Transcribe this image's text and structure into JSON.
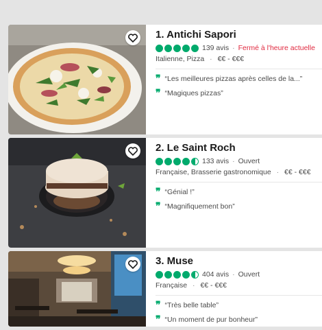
{
  "colors": {
    "accent": "#00aa6c",
    "closed": "#e0293f",
    "background": "#e4e4e4"
  },
  "restaurants": [
    {
      "title": "1. Antichi Sapori",
      "rating": 5.0,
      "reviews": "139 avis",
      "status": "Fermé à l'heure actuelle",
      "status_type": "closed",
      "cuisine": "Italienne, Pizza",
      "price": "€€ - €€€",
      "quotes": [
        "“Les meilleures pizzas après celles de la...”",
        "“Magiques pizzas”"
      ],
      "photo": "pizza-photo",
      "favorite_icon": "heart-icon"
    },
    {
      "title": "2. Le Saint Roch",
      "rating": 4.5,
      "reviews": "133 avis",
      "status": "Ouvert",
      "status_type": "open",
      "cuisine": "Française, Brasserie gastronomique",
      "price": "€€ - €€€",
      "quotes": [
        "“Génial !”",
        "“Magnifiquement bon”"
      ],
      "photo": "dessert-photo",
      "favorite_icon": "heart-icon"
    },
    {
      "title": "3. Muse",
      "rating": 4.5,
      "reviews": "404 avis",
      "status": "Ouvert",
      "status_type": "open",
      "cuisine": "Française",
      "price": "€€ - €€€",
      "quotes": [
        "“Très belle table”",
        "“Un moment de pur bonheur”"
      ],
      "photo": "dining-room-photo",
      "favorite_icon": "heart-icon"
    }
  ]
}
